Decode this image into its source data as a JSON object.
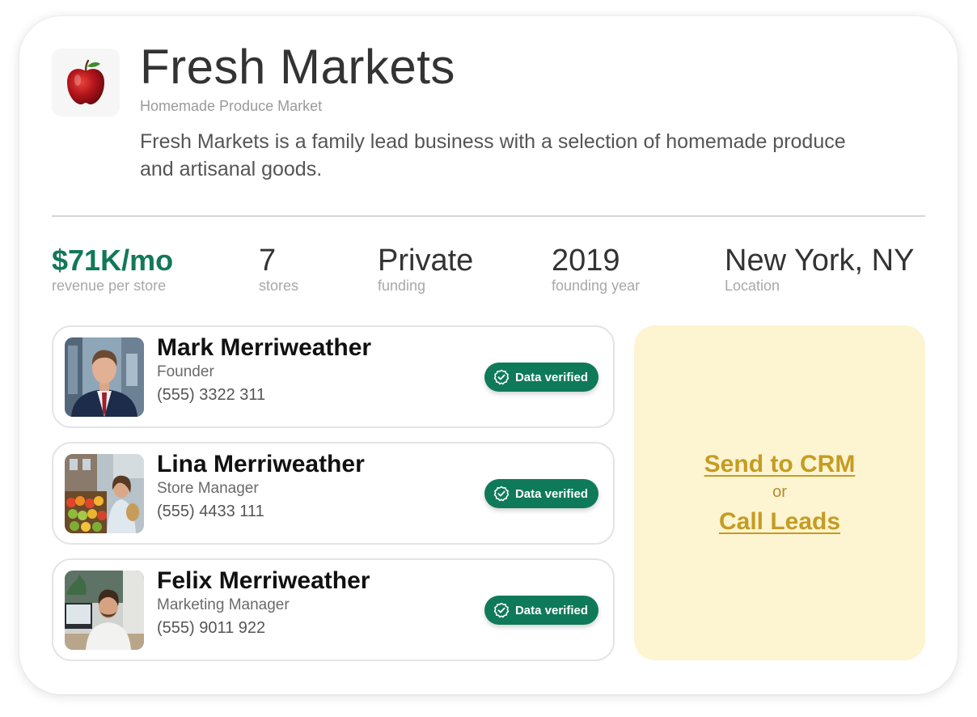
{
  "company": {
    "name": "Fresh Markets",
    "subtitle": "Homemade Produce Market",
    "description": "Fresh Markets is a family lead business with a selection of homemade produce and artisanal goods.",
    "logo_icon": "apple-icon"
  },
  "stats": [
    {
      "value": "$71K/mo",
      "label": "revenue per store"
    },
    {
      "value": "7",
      "label": "stores"
    },
    {
      "value": "Private",
      "label": "funding"
    },
    {
      "value": "2019",
      "label": "founding year"
    },
    {
      "value": "New York, NY",
      "label": "Location"
    }
  ],
  "contacts": [
    {
      "name": "Mark Merriweather",
      "role": "Founder",
      "phone": "(555) 3322 311",
      "badge": "Data verified"
    },
    {
      "name": "Lina Merriweather",
      "role": "Store Manager",
      "phone": "(555) 4433 111",
      "badge": "Data verified"
    },
    {
      "name": "Felix Merriweather",
      "role": "Marketing Manager",
      "phone": "(555) 9011 922",
      "badge": "Data verified"
    }
  ],
  "actions": {
    "send_to_crm": "Send to CRM",
    "or": "or",
    "call_leads": "Call Leads"
  },
  "colors": {
    "accent_green": "#0f7a5a",
    "revenue_green": "#12785a",
    "cta_background": "#fdf4d1",
    "cta_text": "#c59c22"
  }
}
